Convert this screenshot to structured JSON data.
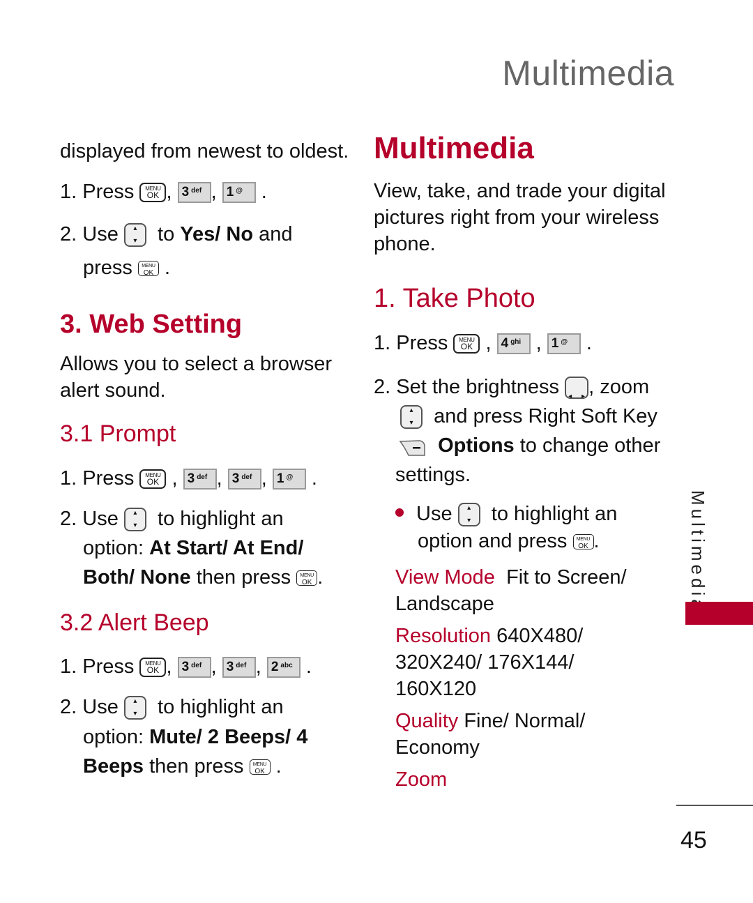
{
  "running_head": "Multimedia",
  "left_column": {
    "intro_text": "displayed from newest to oldest.",
    "intro_steps": [
      {
        "num": "1.",
        "text": "Press",
        "keys": [
          "MENU/OK",
          "3 def",
          "1 @"
        ]
      },
      {
        "num": "2.",
        "pre": "Use",
        "mid": "to",
        "bold": "Yes/ No",
        "post": "and",
        "line2": "press"
      }
    ],
    "web_setting": {
      "heading": "3. Web Setting",
      "description_line1": "Allows you to select a browser",
      "description_line2": "alert sound."
    },
    "prompt": {
      "heading": "3.1 Prompt",
      "step1": {
        "num": "1.",
        "text": "Press",
        "keys": [
          "MENU/OK",
          "3 def",
          "3 def",
          "1 @"
        ]
      },
      "step2": {
        "num": "2.",
        "pre": "Use",
        "post": "to highlight an",
        "line2_pre": "option:",
        "line2_bold": "At Start/ At End/",
        "line3_bold": "Both/ None",
        "line3_post": "then press"
      }
    },
    "alert_beep": {
      "heading": "3.2 Alert Beep",
      "step1": {
        "num": "1.",
        "text": "Press",
        "keys": [
          "MENU/OK",
          "3 def",
          "3 def",
          "2 abc"
        ]
      },
      "step2": {
        "num": "2.",
        "pre": "Use",
        "post": "to highlight an",
        "line2_pre": "option:",
        "line2_bold": "Mute/ 2 Beeps/ 4",
        "line3_bold": "Beeps",
        "line3_post": "then press"
      }
    }
  },
  "right_column": {
    "heading": "Multimedia",
    "description": [
      "View, take, and trade your digital",
      "pictures right from your wireless",
      "phone."
    ],
    "take_photo": {
      "heading": "1. Take Photo",
      "step1": {
        "num": "1.",
        "text": "Press",
        "keys": [
          "MENU/OK",
          "4 ghi",
          "1 @"
        ]
      },
      "step2": {
        "num": "2.",
        "line1_pre": "Set the brightness",
        "line1_post": ", zoom",
        "line2": "and press Right Soft Key",
        "line3_bold": "Options",
        "line3_post": "to change other",
        "line4": "settings."
      },
      "bullet": {
        "pre": "Use",
        "post": "to highlight an",
        "line2": "option and press"
      },
      "options": [
        {
          "label": "View Mode",
          "value_line1": "Fit to Screen/",
          "value_line2": "Landscape"
        },
        {
          "label": "Resolution",
          "value_line1": "640X480/",
          "value_line2": "320X240/ 176X144/",
          "value_line3": "160X120"
        },
        {
          "label": "Quality",
          "value_line1": "Fine/ Normal/",
          "value_line2": "Economy"
        },
        {
          "label": "Zoom"
        }
      ]
    }
  },
  "keys": {
    "menu": "MENU",
    "ok": "OK",
    "k3": "3",
    "k3s": "def",
    "k1": "1",
    "k1s": "@",
    "k2": "2",
    "k2s": "abc",
    "k4": "4",
    "k4s": "ghi"
  },
  "side_tab_label": "Multimedia",
  "page_number": "45",
  "colors": {
    "accent": "#b5002b",
    "running_head": "#666666"
  }
}
